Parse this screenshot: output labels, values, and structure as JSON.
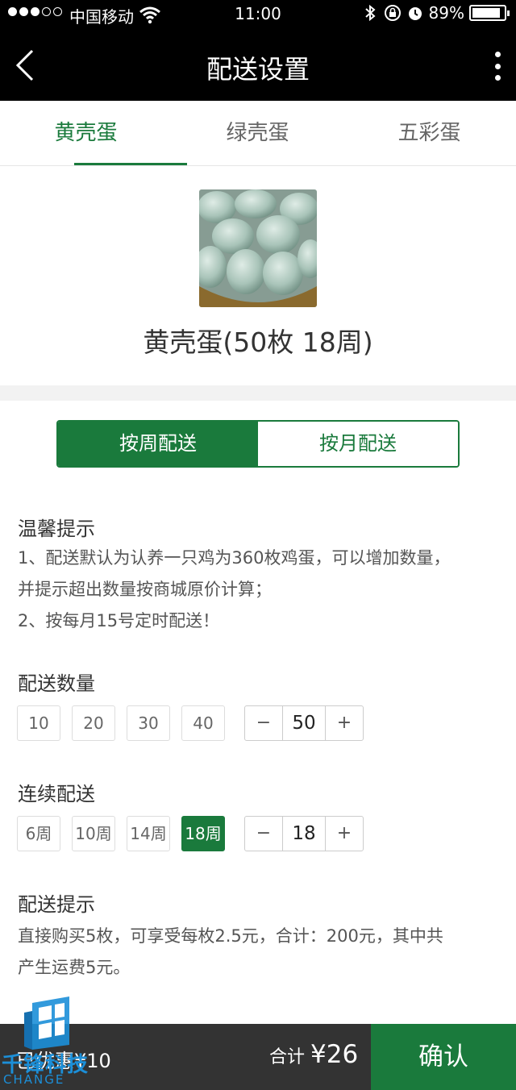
{
  "status_bar": {
    "carrier": "中国移动",
    "time": "11:00",
    "battery": "89%"
  },
  "nav": {
    "title": "配送设置"
  },
  "tabs": [
    {
      "label": "黄壳蛋",
      "active": true
    },
    {
      "label": "绿壳蛋",
      "active": false
    },
    {
      "label": "五彩蛋",
      "active": false
    }
  ],
  "product": {
    "title": "黄壳蛋(50枚 18周)"
  },
  "segment": {
    "weekly": "按周配送",
    "monthly": "按月配送",
    "selected": "weekly"
  },
  "tips": {
    "title": "温馨提示",
    "line1": "1、配送默认为认养一只鸡为360枚鸡蛋，可以增加数量，",
    "line2": "并提示超出数量按商城原价计算；",
    "line3": "2、按每月15号定时配送！"
  },
  "quantity": {
    "title": "配送数量",
    "options": [
      "10",
      "20",
      "30",
      "40"
    ],
    "value": "50",
    "minus": "−",
    "plus": "+"
  },
  "weeks": {
    "title": "连续配送",
    "options": [
      "6周",
      "10周",
      "14周",
      "18周"
    ],
    "selected": "18周",
    "value": "18",
    "minus": "−",
    "plus": "+"
  },
  "delivery_hint": {
    "title": "配送提示",
    "line1": "直接购买5枚，可享受每枚2.5元，合计：200元，其中共",
    "line2": "产生运费5元。"
  },
  "footer": {
    "discount": "已优惠¥10",
    "total_label": "合计",
    "total_amount": "¥26",
    "confirm": "确认"
  },
  "watermark": {
    "text": "千锋科技",
    "sub": "CHANGE"
  },
  "colors": {
    "accent": "#1a7a3c",
    "bottom_bar": "#333333"
  }
}
